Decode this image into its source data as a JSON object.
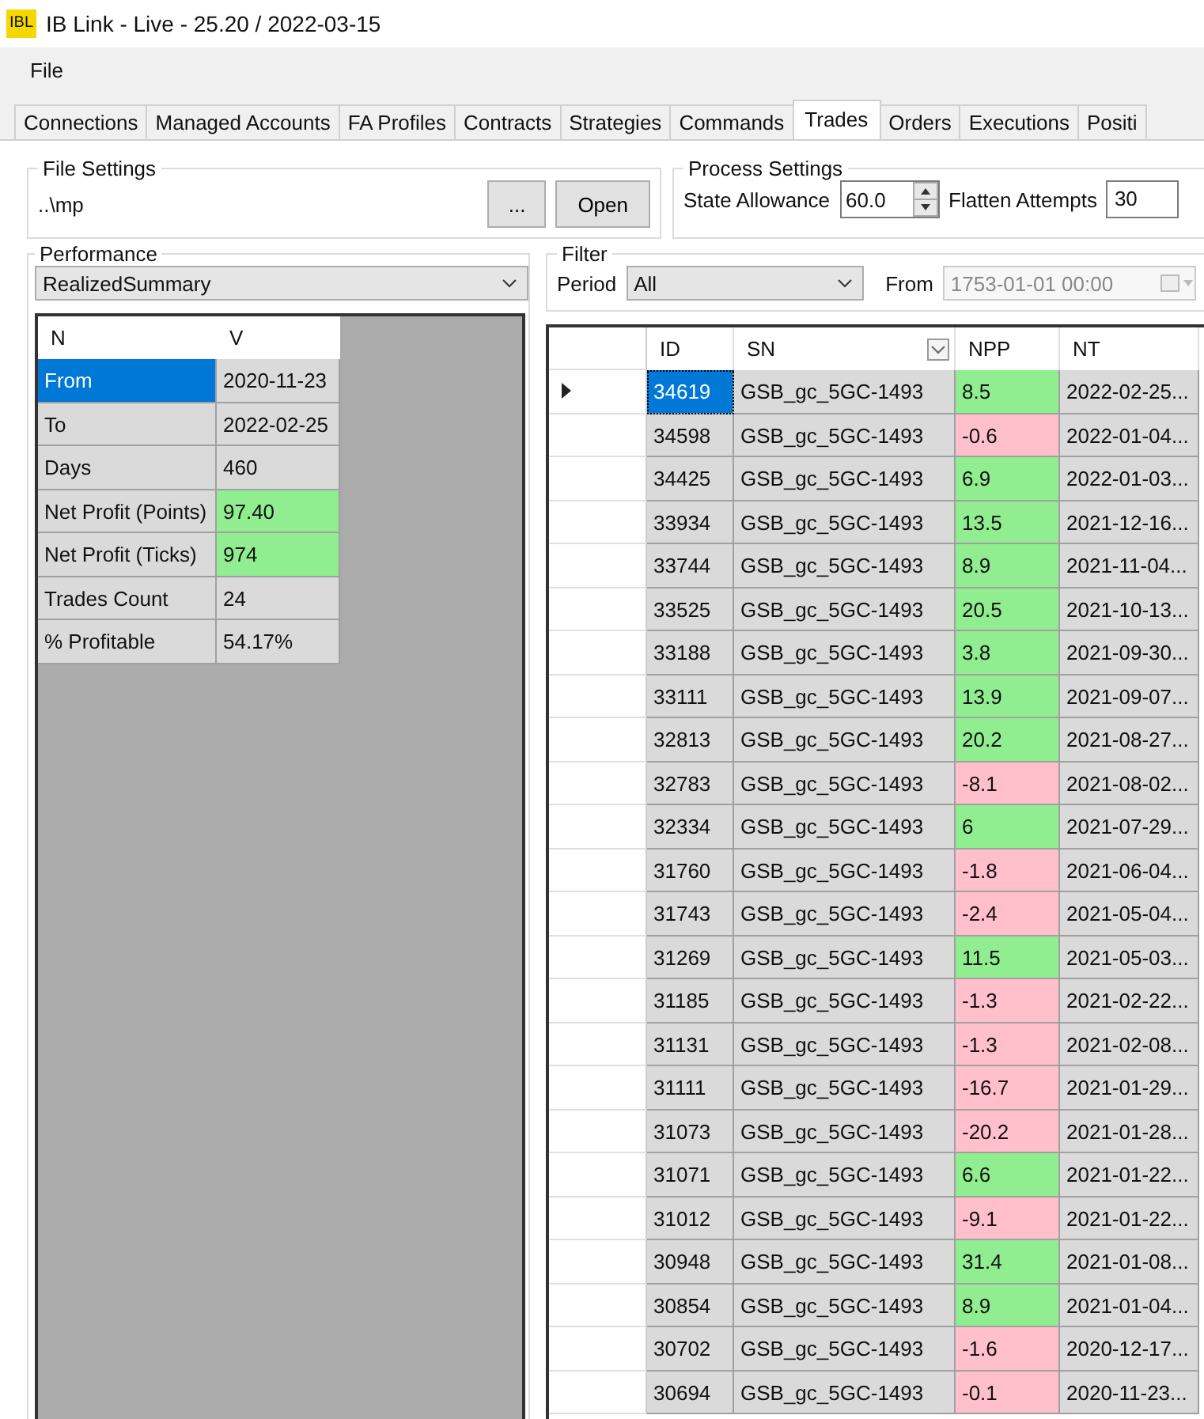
{
  "window": {
    "logo": "IBL",
    "title": "IB Link - Live - 25.20 / 2022-03-15"
  },
  "menu": [
    "File"
  ],
  "tabs": [
    {
      "label": "Connections",
      "selected": false
    },
    {
      "label": "Managed Accounts",
      "selected": false
    },
    {
      "label": "FA Profiles",
      "selected": false
    },
    {
      "label": "Contracts",
      "selected": false
    },
    {
      "label": "Strategies",
      "selected": false
    },
    {
      "label": "Commands",
      "selected": false
    },
    {
      "label": "Trades",
      "selected": true
    },
    {
      "label": "Orders",
      "selected": false
    },
    {
      "label": "Executions",
      "selected": false
    },
    {
      "label": "Positi",
      "selected": false
    }
  ],
  "file_settings": {
    "title": "File Settings",
    "path": "..\\mp",
    "browse_button": "...",
    "open_button": "Open"
  },
  "process_settings": {
    "title": "Process Settings",
    "state_allowance_label": "State Allowance",
    "state_allowance": "60.0",
    "flatten_attempts_label": "Flatten Attempts",
    "flatten_attempts": "30"
  },
  "performance": {
    "title": "Performance",
    "report": "RealizedSummary",
    "columns": [
      "N",
      "V"
    ],
    "rows": [
      {
        "name": "From",
        "value": "2020-11-23",
        "selected": true,
        "highlight": false
      },
      {
        "name": "To",
        "value": "2022-02-25",
        "selected": false,
        "highlight": false
      },
      {
        "name": "Days",
        "value": "460",
        "selected": false,
        "highlight": false
      },
      {
        "name": "Net Profit (Points)",
        "value": "97.40",
        "selected": false,
        "highlight": true
      },
      {
        "name": "Net Profit (Ticks)",
        "value": "974",
        "selected": false,
        "highlight": true
      },
      {
        "name": "Trades Count",
        "value": "24",
        "selected": false,
        "highlight": false
      },
      {
        "name": "% Profitable",
        "value": "54.17%",
        "selected": false,
        "highlight": false
      }
    ]
  },
  "filter": {
    "title": "Filter",
    "period_label": "Period",
    "period": "All",
    "from_label": "From",
    "from": "1753-01-01 00:00"
  },
  "trades": {
    "columns": [
      "ID",
      "SN",
      "NPP",
      "NT"
    ],
    "rows": [
      {
        "id": "34619",
        "sn": "GSB_gc_5GC-1493",
        "npp": "8.5",
        "nt": "2022-02-25...",
        "kind": "profit",
        "selected": true
      },
      {
        "id": "34598",
        "sn": "GSB_gc_5GC-1493",
        "npp": "-0.6",
        "nt": "2022-01-04...",
        "kind": "loss",
        "selected": false
      },
      {
        "id": "34425",
        "sn": "GSB_gc_5GC-1493",
        "npp": "6.9",
        "nt": "2022-01-03...",
        "kind": "profit",
        "selected": false
      },
      {
        "id": "33934",
        "sn": "GSB_gc_5GC-1493",
        "npp": "13.5",
        "nt": "2021-12-16...",
        "kind": "profit",
        "selected": false
      },
      {
        "id": "33744",
        "sn": "GSB_gc_5GC-1493",
        "npp": "8.9",
        "nt": "2021-11-04...",
        "kind": "profit",
        "selected": false
      },
      {
        "id": "33525",
        "sn": "GSB_gc_5GC-1493",
        "npp": "20.5",
        "nt": "2021-10-13...",
        "kind": "profit",
        "selected": false
      },
      {
        "id": "33188",
        "sn": "GSB_gc_5GC-1493",
        "npp": "3.8",
        "nt": "2021-09-30...",
        "kind": "profit",
        "selected": false
      },
      {
        "id": "33111",
        "sn": "GSB_gc_5GC-1493",
        "npp": "13.9",
        "nt": "2021-09-07...",
        "kind": "profit",
        "selected": false
      },
      {
        "id": "32813",
        "sn": "GSB_gc_5GC-1493",
        "npp": "20.2",
        "nt": "2021-08-27...",
        "kind": "profit",
        "selected": false
      },
      {
        "id": "32783",
        "sn": "GSB_gc_5GC-1493",
        "npp": "-8.1",
        "nt": "2021-08-02...",
        "kind": "loss",
        "selected": false
      },
      {
        "id": "32334",
        "sn": "GSB_gc_5GC-1493",
        "npp": "6",
        "nt": "2021-07-29...",
        "kind": "profit",
        "selected": false
      },
      {
        "id": "31760",
        "sn": "GSB_gc_5GC-1493",
        "npp": "-1.8",
        "nt": "2021-06-04...",
        "kind": "loss",
        "selected": false
      },
      {
        "id": "31743",
        "sn": "GSB_gc_5GC-1493",
        "npp": "-2.4",
        "nt": "2021-05-04...",
        "kind": "loss",
        "selected": false
      },
      {
        "id": "31269",
        "sn": "GSB_gc_5GC-1493",
        "npp": "11.5",
        "nt": "2021-05-03...",
        "kind": "profit",
        "selected": false
      },
      {
        "id": "31185",
        "sn": "GSB_gc_5GC-1493",
        "npp": "-1.3",
        "nt": "2021-02-22...",
        "kind": "loss",
        "selected": false
      },
      {
        "id": "31131",
        "sn": "GSB_gc_5GC-1493",
        "npp": "-1.3",
        "nt": "2021-02-08...",
        "kind": "loss",
        "selected": false
      },
      {
        "id": "31111",
        "sn": "GSB_gc_5GC-1493",
        "npp": "-16.7",
        "nt": "2021-01-29...",
        "kind": "loss",
        "selected": false
      },
      {
        "id": "31073",
        "sn": "GSB_gc_5GC-1493",
        "npp": "-20.2",
        "nt": "2021-01-28...",
        "kind": "loss",
        "selected": false
      },
      {
        "id": "31071",
        "sn": "GSB_gc_5GC-1493",
        "npp": "6.6",
        "nt": "2021-01-22...",
        "kind": "profit",
        "selected": false
      },
      {
        "id": "31012",
        "sn": "GSB_gc_5GC-1493",
        "npp": "-9.1",
        "nt": "2021-01-22...",
        "kind": "loss",
        "selected": false
      },
      {
        "id": "30948",
        "sn": "GSB_gc_5GC-1493",
        "npp": "31.4",
        "nt": "2021-01-08...",
        "kind": "profit",
        "selected": false
      },
      {
        "id": "30854",
        "sn": "GSB_gc_5GC-1493",
        "npp": "8.9",
        "nt": "2021-01-04...",
        "kind": "profit",
        "selected": false
      },
      {
        "id": "30702",
        "sn": "GSB_gc_5GC-1493",
        "npp": "-1.6",
        "nt": "2020-12-17...",
        "kind": "loss",
        "selected": false
      },
      {
        "id": "30694",
        "sn": "GSB_gc_5GC-1493",
        "npp": "-0.1",
        "nt": "2020-11-23...",
        "kind": "loss",
        "selected": false
      }
    ]
  }
}
